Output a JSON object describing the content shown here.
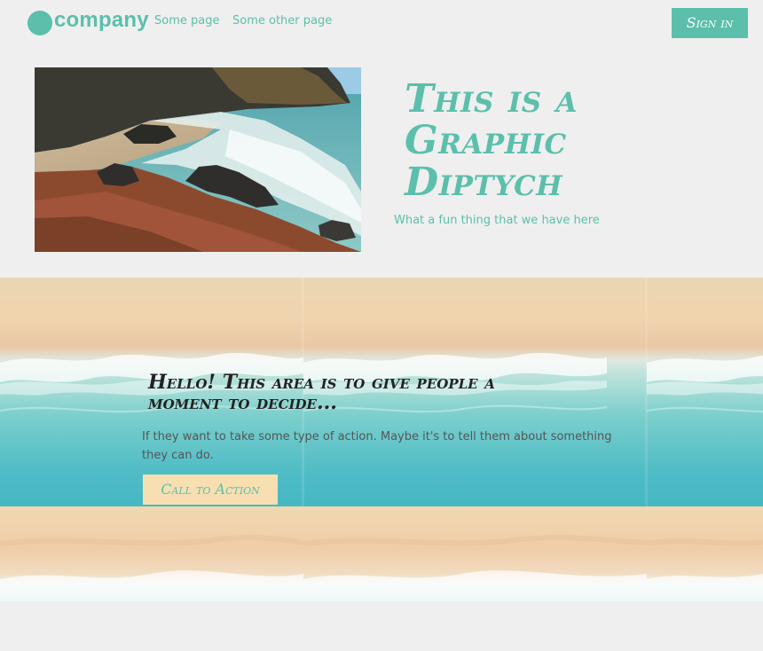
{
  "header": {
    "logo_text": "company",
    "nav": [
      "Some page",
      "Some other page"
    ],
    "signin_label": "Sign in"
  },
  "diptych": {
    "title": "This is a Graphic Diptych",
    "subtitle": "What a fun thing that we have here"
  },
  "cta": {
    "heading": "Hello! This area is to give people a moment to decide...",
    "text": "If they want to take some type of action. Maybe it's to tell them about something they can do.",
    "button_label": "Call to Action"
  },
  "colors": {
    "accent": "#5bbfab",
    "background": "#efefef",
    "cta_button_bg": "#f7dfb2"
  }
}
